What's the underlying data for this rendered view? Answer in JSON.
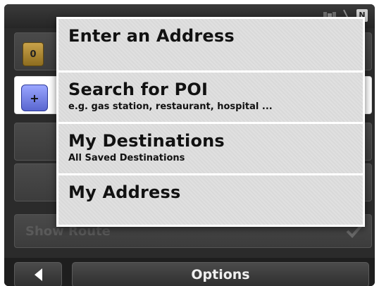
{
  "status": {
    "battery_label": "N"
  },
  "route": {
    "origin_marker": "0",
    "add_stop_symbol": "+",
    "show_route_label": "Show Route"
  },
  "menu": {
    "items": [
      {
        "title": "Enter an Address",
        "subtitle": ""
      },
      {
        "title": "Search for POI",
        "subtitle": "e.g. gas station, restaurant, hospital ..."
      },
      {
        "title": "My Destinations",
        "subtitle": "All Saved Destinations"
      },
      {
        "title": "My Address",
        "subtitle": ""
      }
    ]
  },
  "bottom_bar": {
    "options_label": "Options"
  },
  "icons": {
    "satellite": "satellite-icon",
    "signal": "signal-icon",
    "back": "back-arrow-icon",
    "check": "check-icon"
  }
}
